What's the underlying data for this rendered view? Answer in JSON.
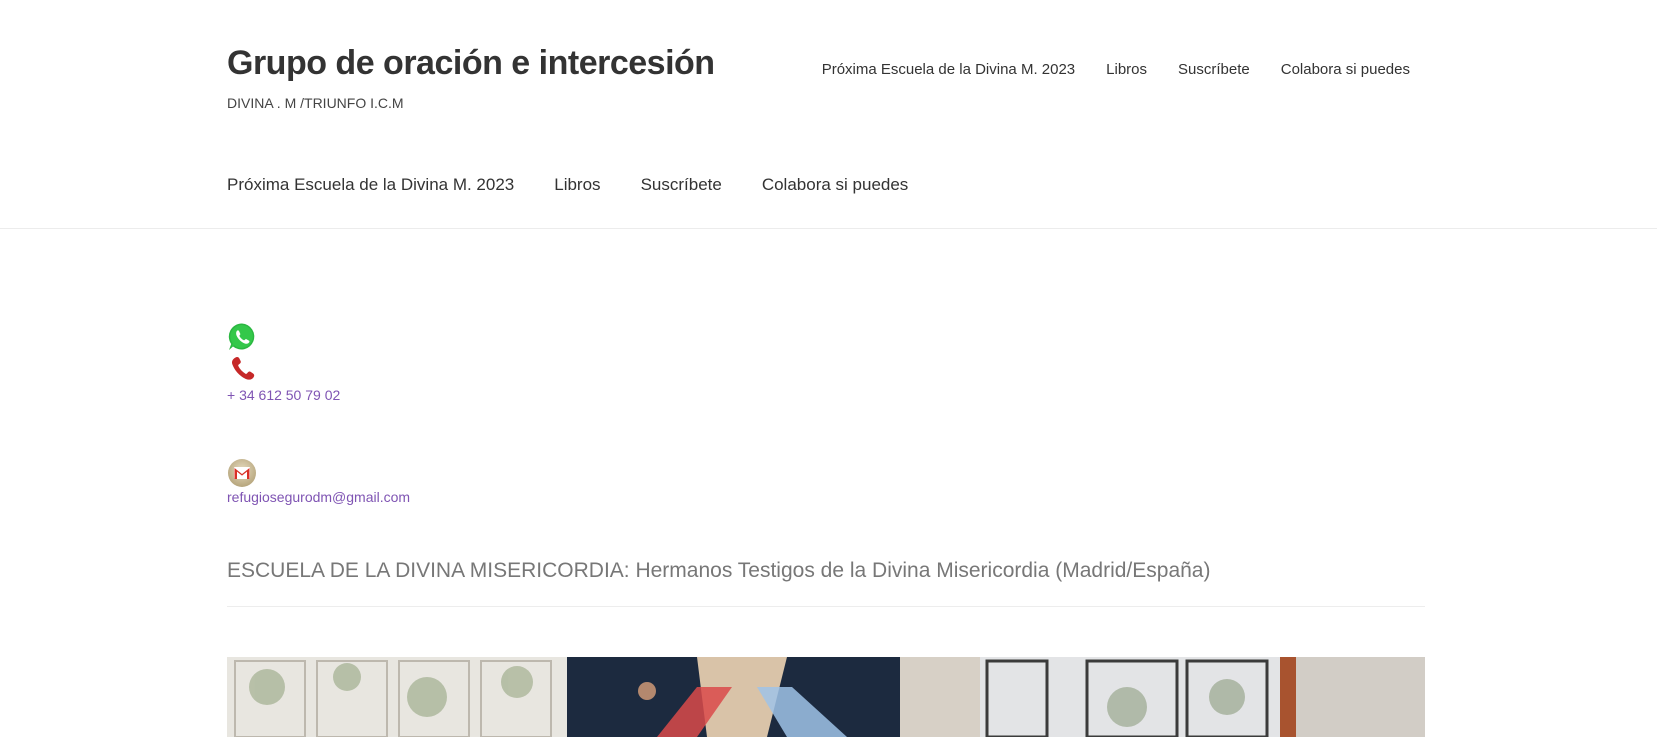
{
  "header": {
    "site_title": "Grupo de oración e intercesión",
    "tagline": "DIVINA . M /TRIUNFO I.C.M",
    "top_nav": [
      {
        "label": "Próxima Escuela de la Divina M. 2023"
      },
      {
        "label": "Libros"
      },
      {
        "label": "Suscríbete"
      },
      {
        "label": "Colabora si puedes"
      }
    ]
  },
  "main_nav": [
    {
      "label": "Próxima Escuela de la Divina M. 2023"
    },
    {
      "label": "Libros"
    },
    {
      "label": "Suscríbete"
    },
    {
      "label": "Colabora si puedes"
    }
  ],
  "contact": {
    "phone": "+ 34 612 50 79 02",
    "email": "refugiosegurodm@gmail.com",
    "icons": [
      "whatsapp-icon",
      "phone-icon",
      "gmail-icon"
    ]
  },
  "post": {
    "title": "ESCUELA DE LA DIVINA MISERICORDIA: Hermanos Testigos de la Divina Misericordia (Madrid/España)"
  },
  "colors": {
    "link": "#7f54b3",
    "text": "#333333",
    "title_muted": "#777777",
    "whatsapp_green": "#2bb741",
    "phone_red": "#c62828"
  }
}
